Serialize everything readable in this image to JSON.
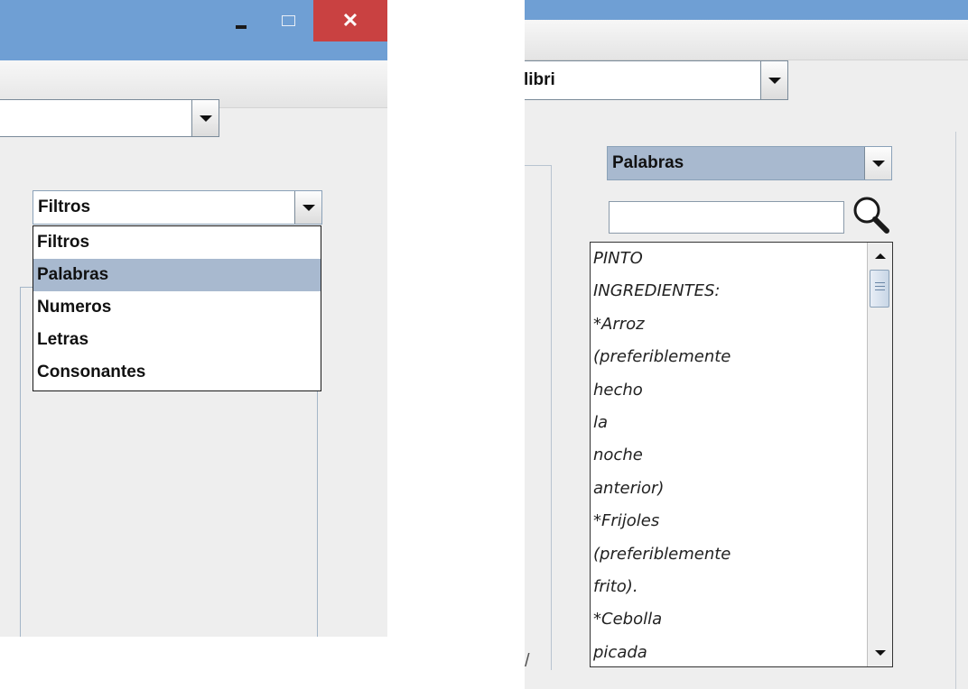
{
  "left_window": {
    "title_buttons": {
      "minimize_icon": "minimize-icon",
      "maximize_icon": "maximize-icon",
      "close_label": "✕"
    },
    "font_combo": {
      "value": ""
    },
    "filter_combo": {
      "selected": "Filtros",
      "options": [
        "Filtros",
        "Palabras",
        "Numeros",
        "Letras",
        "Consonantes"
      ],
      "highlighted": "Palabras"
    }
  },
  "right_window": {
    "font_combo": {
      "value": "libri"
    },
    "mode_combo": {
      "selected": "Palabras"
    },
    "search": {
      "value": "",
      "icon": "magnifier-icon"
    },
    "text_area": {
      "lines": [
        "PINTO",
        "INGREDIENTES:",
        "*Arroz",
        "(preferiblemente",
        "hecho",
        "la",
        "noche",
        "anterior)",
        "*Frijoles",
        "(preferiblemente",
        "frito).",
        "*Cebolla",
        "picada"
      ]
    },
    "stray_mark": "/"
  },
  "colors": {
    "titlebar": "#6f9fd4",
    "close": "#c94141",
    "selection": "#a8b9cf",
    "panel": "#eeeeee"
  }
}
